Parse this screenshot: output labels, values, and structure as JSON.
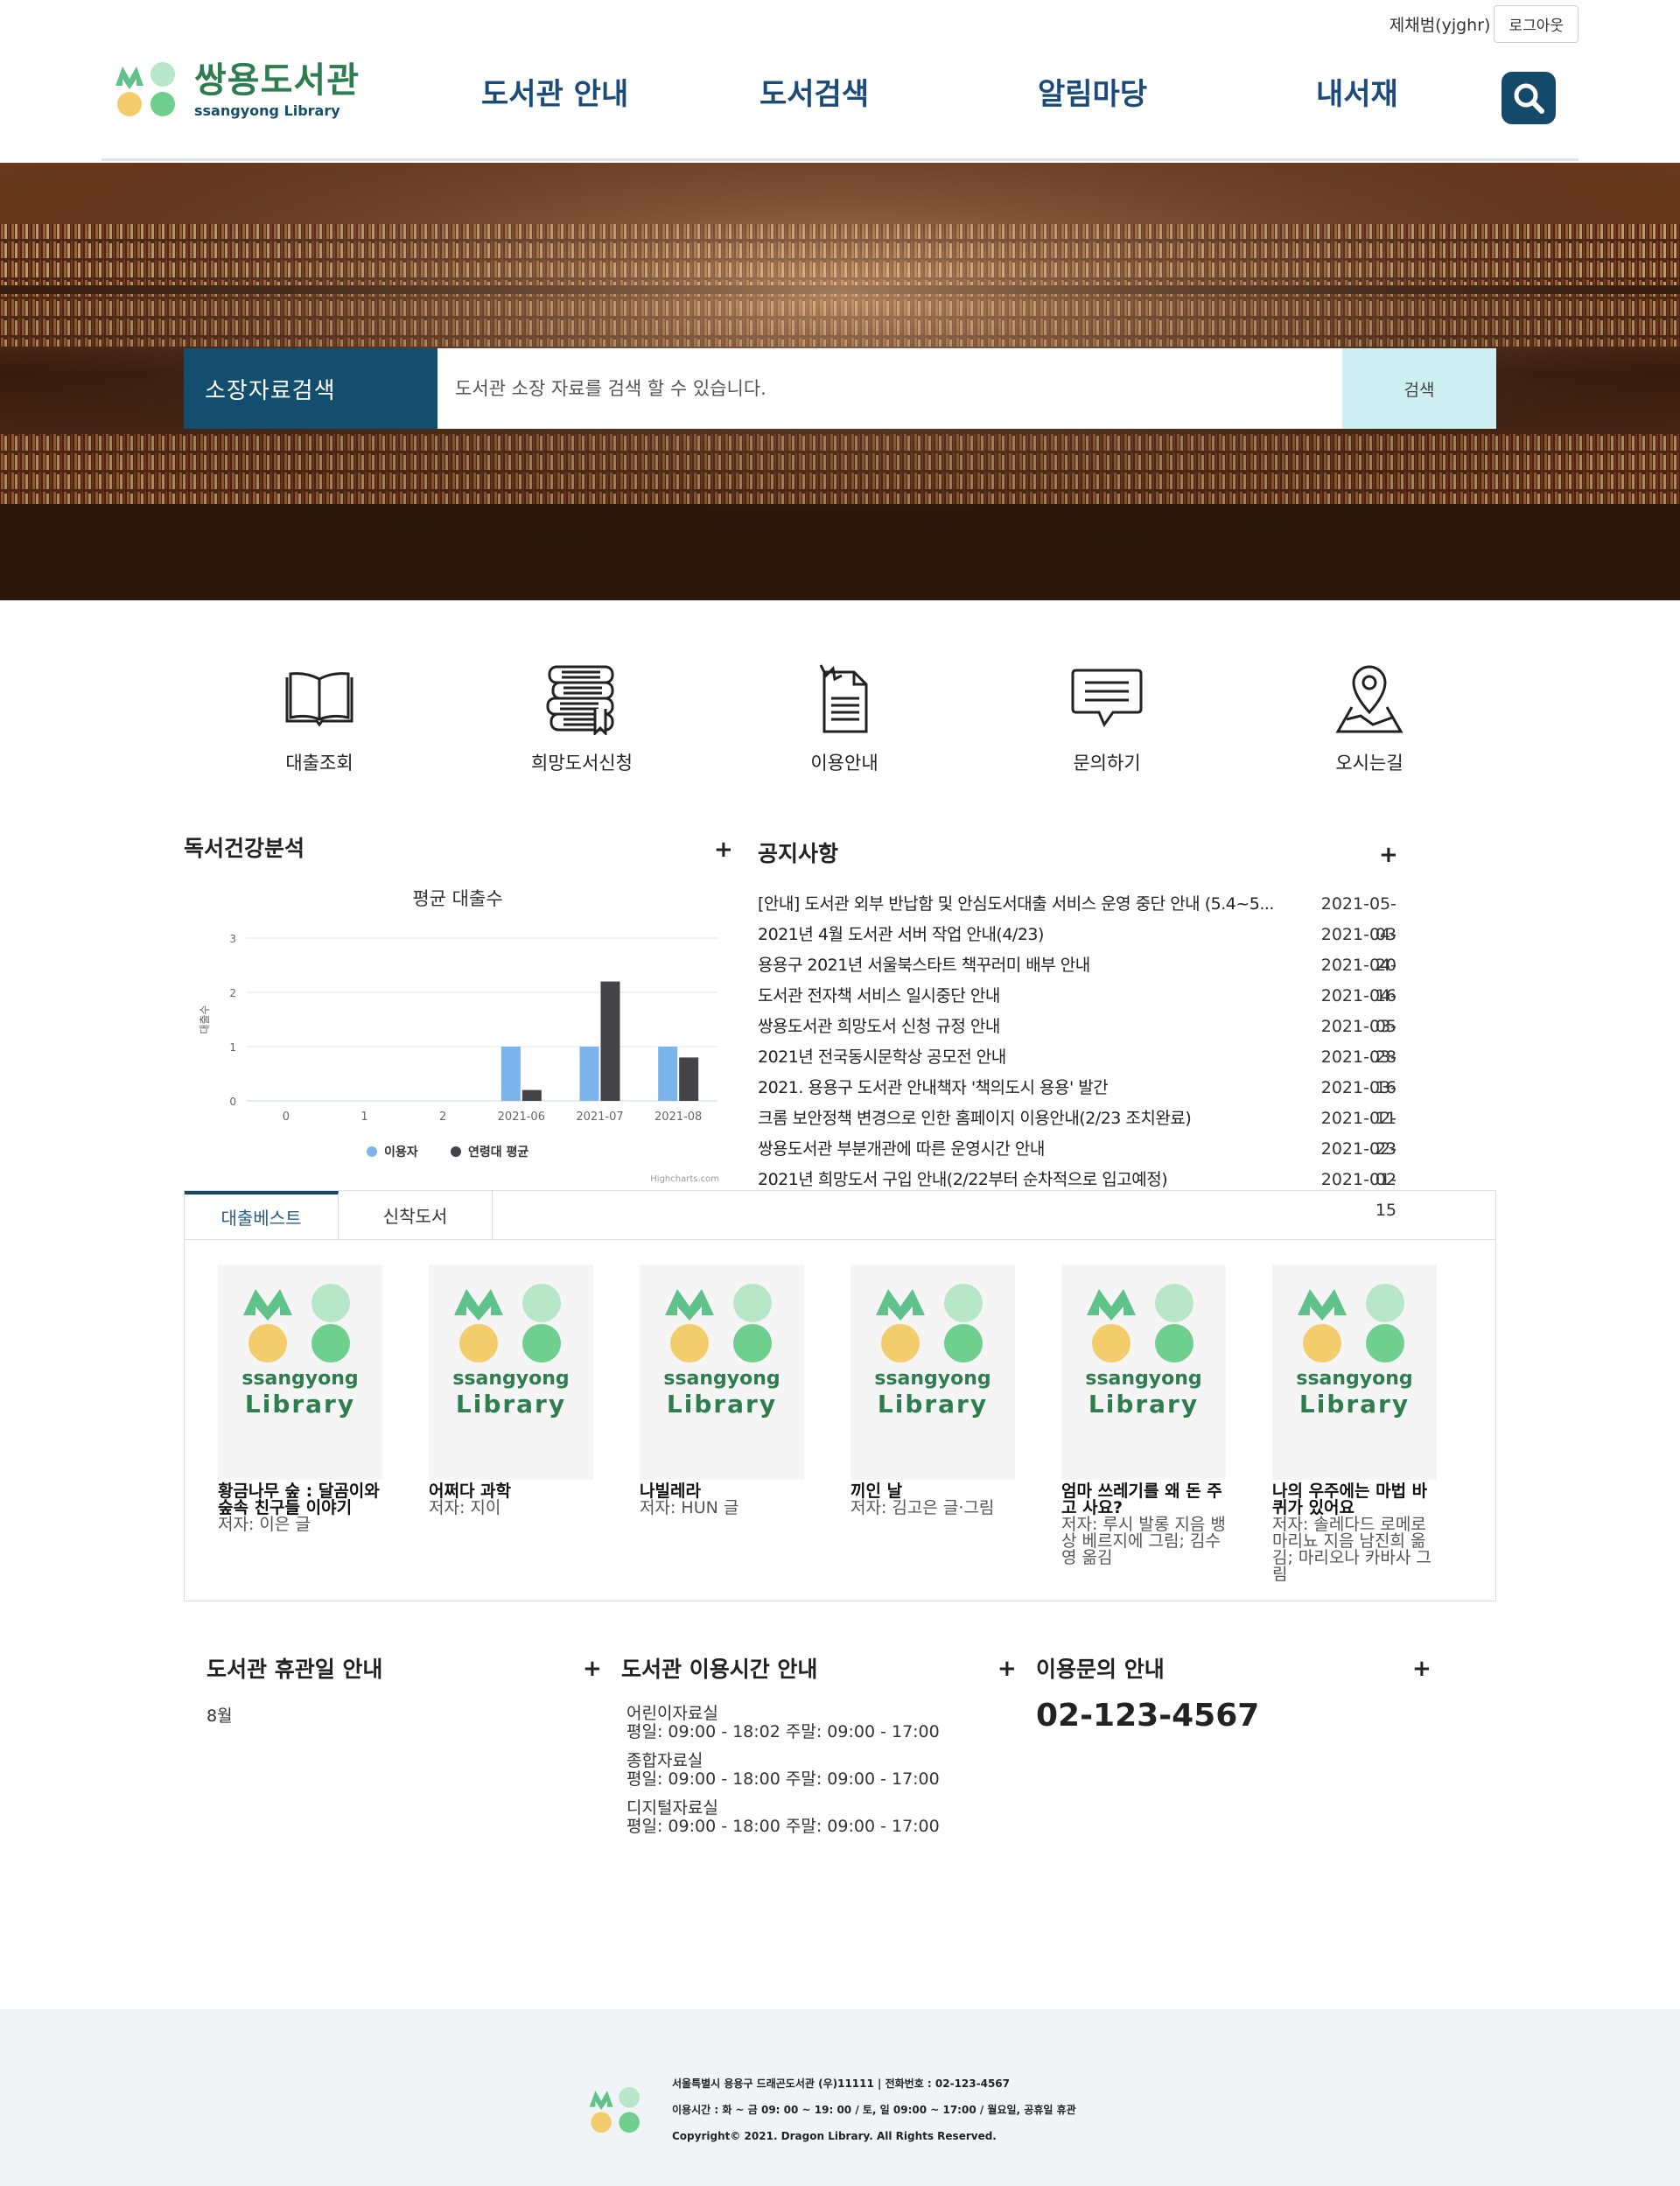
{
  "topbar": {
    "user": "제채범(yjghr)",
    "logout": "로그아웃"
  },
  "header": {
    "logo_title": "쌍용도서관",
    "logo_sub": "ssangyong Library",
    "nav": [
      "도서관 안내",
      "도서검색",
      "알림마당",
      "내서재"
    ]
  },
  "hero": {
    "label": "소장자료검색",
    "placeholder": "도서관 소장 자료를 검색 할 수 있습니다.",
    "button": "검색"
  },
  "quick_menu": [
    {
      "label": "대출조회",
      "icon": "book-open-icon"
    },
    {
      "label": "희망도서신청",
      "icon": "books-stack-icon"
    },
    {
      "label": "이용안내",
      "icon": "document-icon"
    },
    {
      "label": "문의하기",
      "icon": "chat-bubble-icon"
    },
    {
      "label": "오시는길",
      "icon": "map-pin-icon"
    }
  ],
  "reading": {
    "title": "독서건강분석",
    "plus": "+",
    "credit": "Highcharts.com"
  },
  "chart_data": {
    "type": "bar",
    "title": "평균 대출수",
    "ylabel": "대출수",
    "xlabel": "",
    "categories": [
      "0",
      "1",
      "2",
      "2021-06",
      "2021-07",
      "2021-08"
    ],
    "ylim": [
      0,
      3
    ],
    "yticks": [
      0,
      1,
      2,
      3
    ],
    "series": [
      {
        "name": "이용자",
        "color": "#7cb5ec",
        "values": [
          0,
          0,
          0,
          1,
          1,
          1
        ]
      },
      {
        "name": "연령대 평균",
        "color": "#434348",
        "values": [
          0,
          0,
          0,
          0.2,
          2.2,
          0.8
        ]
      }
    ],
    "grid": true,
    "legend": "bottom"
  },
  "notices": {
    "title": "공지사항",
    "plus": "+",
    "items": [
      {
        "title": "[안내] 도서관 외부 반납함 및 안심도서대출 서비스 운영 중단 안내 (5.4~5...",
        "date": "2021-05-03"
      },
      {
        "title": "2021년 4월 도서관 서버 작업 안내(4/23)",
        "date": "2021-04-20"
      },
      {
        "title": "용용구 2021년 서울북스타트 책꾸러미 배부 안내",
        "date": "2021-04-16"
      },
      {
        "title": "도서관 전자책 서비스 일시중단 안내",
        "date": "2021-04-05"
      },
      {
        "title": "쌍용도서관 희망도서 신청 규정 안내",
        "date": "2021-03-28"
      },
      {
        "title": "2021년 전국동시문학상 공모전 안내",
        "date": "2021-03-16"
      },
      {
        "title": "2021. 용용구 도서관 안내책자 '책의도시 용용' 발간",
        "date": "2021-03-11"
      },
      {
        "title": "크롬 보안정책 변경으로 인한 홈페이지 이용안내(2/23 조치완료)",
        "date": "2021-02-23"
      },
      {
        "title": "쌍용도서관 부분개관에 따른 운영시간 안내",
        "date": "2021-02-02"
      },
      {
        "title": "2021년 희망도서 구입 안내(2/22부터 순차적으로 입고예정)",
        "date": "2021-01-15"
      }
    ]
  },
  "books": {
    "tabs": [
      "대출베스트",
      "신착도서"
    ],
    "cover_line1": "ssangyong",
    "cover_line2": "Library",
    "items": [
      {
        "title": "황금나무 숲 : 달곰이와 숲속 친구들 이야기",
        "author": "저자: 이은 글"
      },
      {
        "title": "어쩌다 과학",
        "author": "저자: 지이"
      },
      {
        "title": "나빌레라",
        "author": "저자: HUN 글"
      },
      {
        "title": "끼인 날",
        "author": "저자: 김고은 글·그림"
      },
      {
        "title": "엄마 쓰레기를 왜 돈 주고 사요?",
        "author": "저자: 루시 발롱 지음 뱅상 베르지에 그림; 김수영 옮김"
      },
      {
        "title": "나의 우주에는 마법 바퀴가 있어요",
        "author": "저자: 솔레다드 로메로 마리뇨 지음 남진희 옮김; 마리오나 카바사 그림"
      }
    ]
  },
  "closed": {
    "title": "도서관 휴관일 안내",
    "plus": "+",
    "month": "8월"
  },
  "hours": {
    "title": "도서관 이용시간 안내",
    "plus": "+",
    "rooms": [
      {
        "name": "어린이자료실",
        "time": "평일: 09:00 - 18:02 주말: 09:00 - 17:00"
      },
      {
        "name": "종합자료실",
        "time": "평일: 09:00 - 18:00 주말: 09:00 - 17:00"
      },
      {
        "name": "디지털자료실",
        "time": "평일: 09:00 - 18:00 주말: 09:00 - 17:00"
      }
    ]
  },
  "contact": {
    "title": "이용문의 안내",
    "plus": "+",
    "phone": "02-123-4567"
  },
  "footer": {
    "line1": "서울특별시 용용구 드래곤도서관 (우)11111 | 전화번호 : 02-123-4567",
    "line2": "이용시간 : 화 ~ 금 09: 00 ~ 19: 00 / 토, 일 09:00 ~ 17:00 / 월요일, 공휴일 휴관",
    "line3": "Copyright© 2021. Dragon Library. All Rights Reserved."
  },
  "colors": {
    "primary": "#134a6b",
    "logo_green": "#2e7d4f",
    "hero_button": "#cdeff1"
  }
}
